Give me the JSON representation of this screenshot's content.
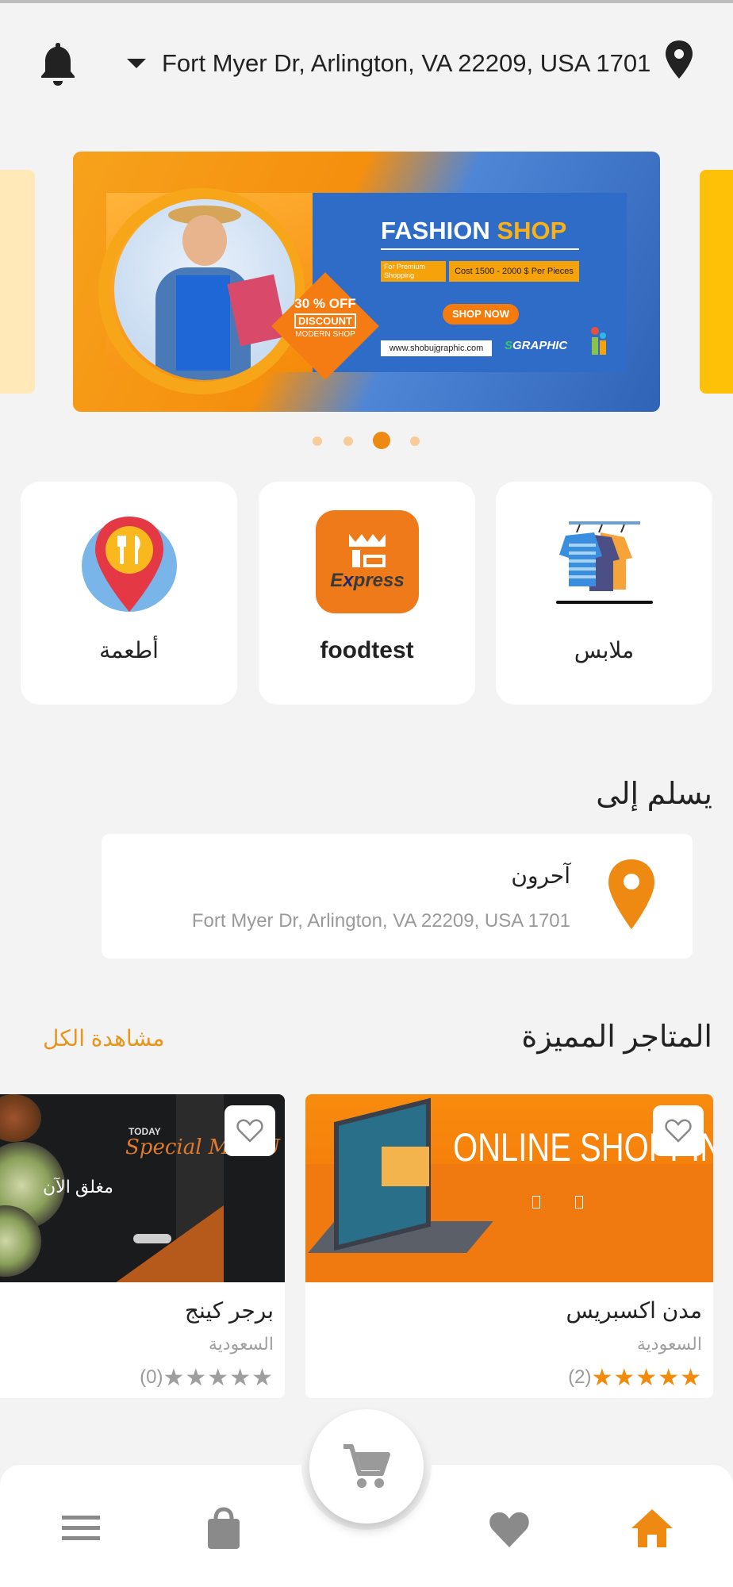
{
  "header": {
    "address": "Fort Myer Dr, Arlington, VA 22209, USA 1701",
    "bell_icon": "bell-icon",
    "location_icon": "location-pin-icon"
  },
  "banner": {
    "title_part1": "FASHION",
    "title_part2": "SHOP",
    "tag_left": "For Premium Shopping",
    "tag_right": "Cost 1500 - 2000 $ Per Pieces",
    "discount_pct": "30 % OFF",
    "discount_label": "DISCOUNT",
    "discount_sub": "MODERN SHOP",
    "cta": "SHOP NOW",
    "url": "www.shobujgraphic.com",
    "logo": "GRAPHIC",
    "active_slide": 3,
    "slide_count": 4
  },
  "categories": [
    {
      "label": "أطعمة",
      "icon": "food-pin-icon"
    },
    {
      "label": "foodtest",
      "icon": "express-logo-icon"
    },
    {
      "label": "ملابس",
      "icon": "clothes-rack-icon"
    }
  ],
  "delivery": {
    "title": "يسلم إلى",
    "name": "آحرون",
    "address": "Fort Myer Dr, Arlington, VA 22209, USA 1701"
  },
  "featured": {
    "title": "المتاجر المميزة",
    "see_all": "مشاهدة الكل",
    "stores": [
      {
        "name": "مدن اكسبريس",
        "country": "السعودية",
        "rating": 5,
        "count": "(2)",
        "banner_title": "ONLINE SHOPPING",
        "status": ""
      },
      {
        "name": "برجر كينج",
        "country": "السعودية",
        "rating": 0,
        "count": "(0)",
        "banner_title": "Special MENU",
        "status": "مغلق الآن",
        "banner_today": "TODAY"
      }
    ]
  },
  "colors": {
    "accent": "#EE8A12",
    "star_active": "#F28A0A",
    "star_inactive": "#9E9E9E",
    "background": "#F3F3F3"
  },
  "bottom_nav": {
    "items": [
      "menu-icon",
      "shopping-bag-icon",
      "cart-icon",
      "heart-icon",
      "home-icon"
    ],
    "active": "home-icon"
  }
}
